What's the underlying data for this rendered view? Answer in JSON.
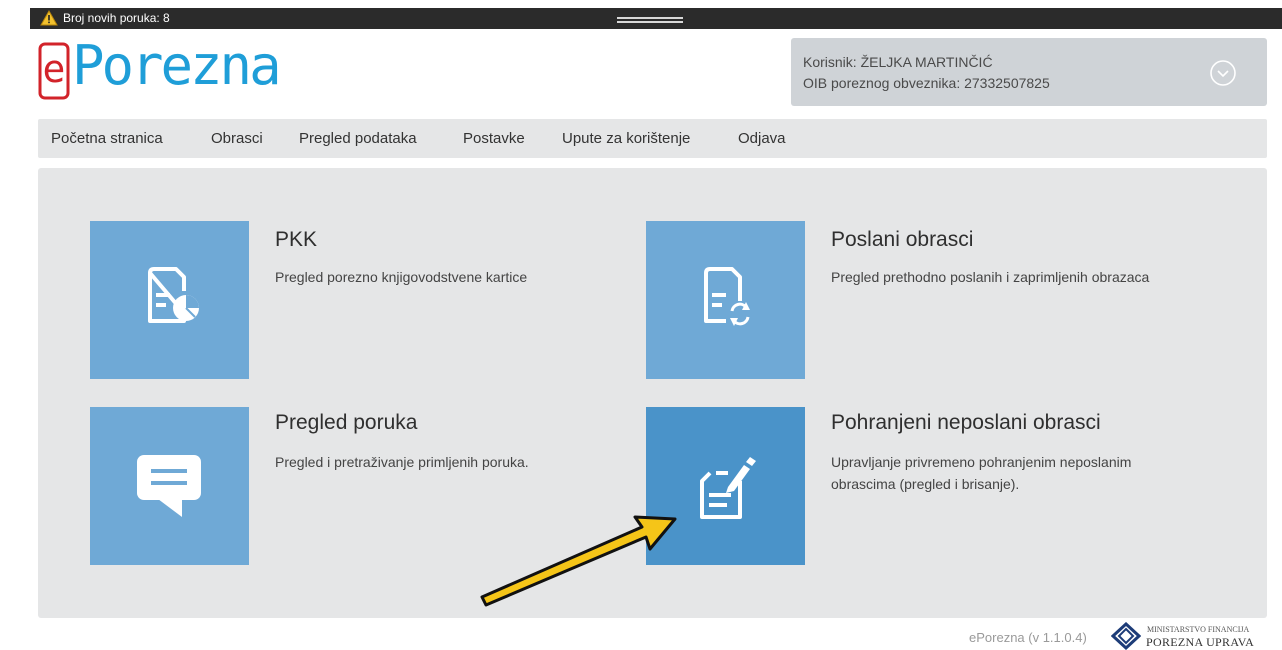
{
  "notification": {
    "text": "Broj novih poruka: 8"
  },
  "logo": {
    "e": "e",
    "rest": "Porezna"
  },
  "user": {
    "line1": "Korisnik: ŽELJKA MARTINČIĆ",
    "line2": "OIB poreznog obveznika: 27332507825"
  },
  "nav": [
    {
      "label": "Početna stranica"
    },
    {
      "label": "Obrasci"
    },
    {
      "label": "Pregled podataka"
    },
    {
      "label": "Postavke"
    },
    {
      "label": "Upute za korištenje"
    },
    {
      "label": "Odjava"
    }
  ],
  "cards": [
    {
      "title": "PKK",
      "desc": "Pregled porezno knjigovodstvene kartice",
      "icon": "document-chart-icon"
    },
    {
      "title": "Poslani obrasci",
      "desc": "Pregled prethodno poslanih i zaprimljenih obrazaca",
      "icon": "document-refresh-icon"
    },
    {
      "title": "Pregled poruka",
      "desc": "Pregled i pretraživanje primljenih poruka.",
      "icon": "message-icon"
    },
    {
      "title": "Pohranjeni neposlani obrasci",
      "desc": "Upravljanje privremeno pohranjenim neposlanim obrascima (pregled i brisanje).",
      "icon": "document-edit-icon"
    }
  ],
  "footer": {
    "version": "ePorezna (v 1.1.0.4)",
    "ministry": "MINISTARSTVO FINANCIJA",
    "agency": "POREZNA UPRAVA"
  },
  "colors": {
    "tile": "#6fa9d6",
    "tile_active": "#4a93c9",
    "brand_blue": "#1f9ed8",
    "brand_red": "#d2232a",
    "panel": "#e5e6e7",
    "annotation_arrow": "#f5c518"
  }
}
